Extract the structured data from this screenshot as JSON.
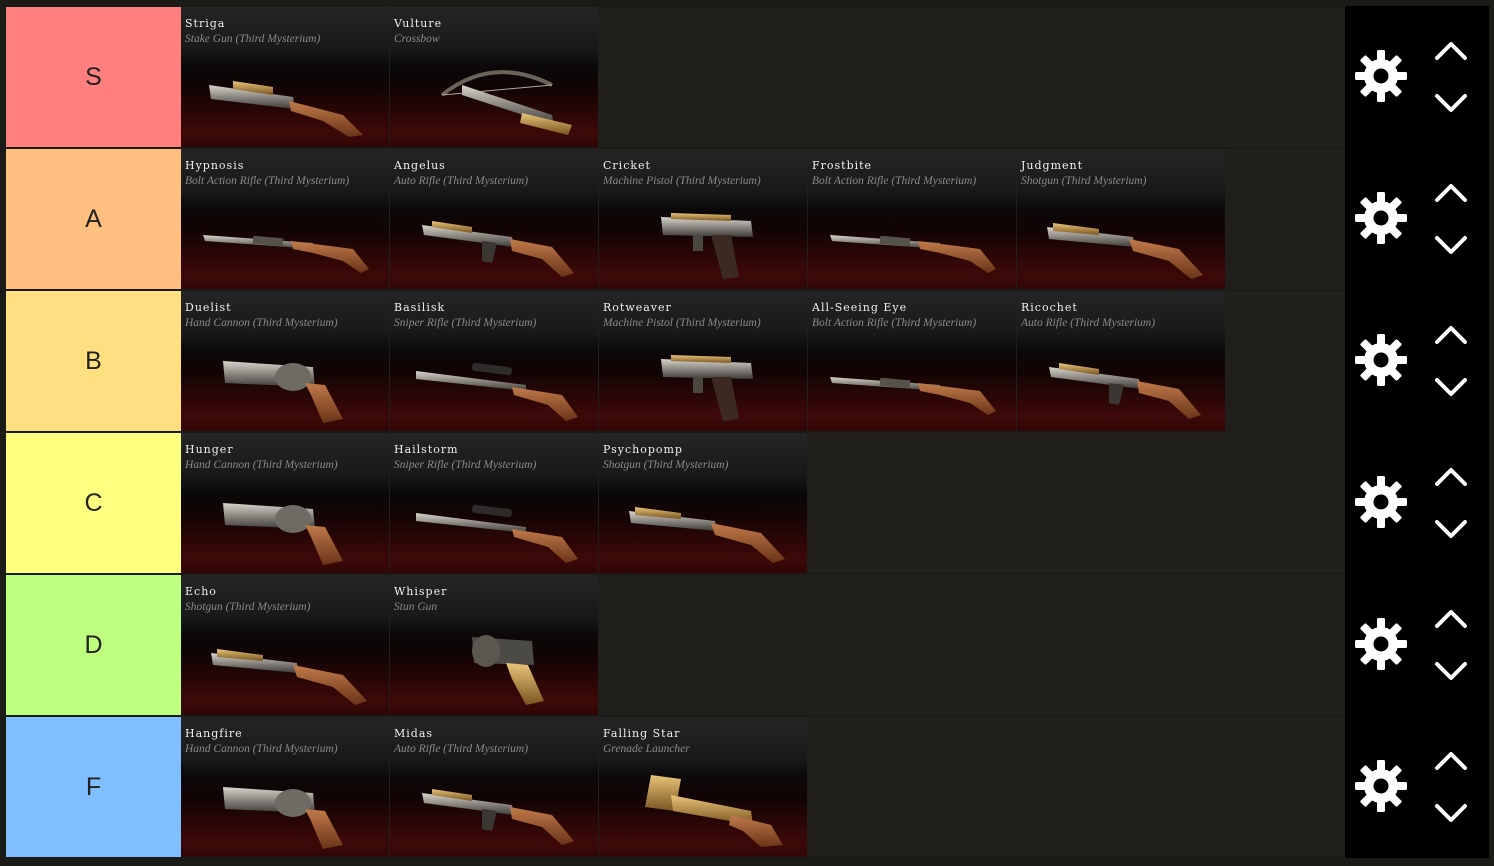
{
  "tiers": [
    {
      "label": "S",
      "color": "#ff7f7f",
      "items": [
        {
          "name": "Striga",
          "type": "Stake Gun (Third Mysterium)",
          "icon": "stake-gun-icon"
        },
        {
          "name": "Vulture",
          "type": "Crossbow",
          "icon": "crossbow-icon"
        }
      ]
    },
    {
      "label": "A",
      "color": "#ffbf7f",
      "items": [
        {
          "name": "Hypnosis",
          "type": "Bolt Action Rifle (Third Mysterium)",
          "icon": "bolt-action-rifle-icon"
        },
        {
          "name": "Angelus",
          "type": "Auto Rifle (Third Mysterium)",
          "icon": "auto-rifle-icon"
        },
        {
          "name": "Cricket",
          "type": "Machine Pistol (Third Mysterium)",
          "icon": "machine-pistol-icon"
        },
        {
          "name": "Frostbite",
          "type": "Bolt Action Rifle (Third Mysterium)",
          "icon": "bolt-action-rifle-icon"
        },
        {
          "name": "Judgment",
          "type": "Shotgun (Third Mysterium)",
          "icon": "shotgun-icon"
        }
      ]
    },
    {
      "label": "B",
      "color": "#ffdf7f",
      "items": [
        {
          "name": "Duelist",
          "type": "Hand Cannon (Third Mysterium)",
          "icon": "hand-cannon-icon"
        },
        {
          "name": "Basilisk",
          "type": "Sniper Rifle (Third Mysterium)",
          "icon": "sniper-rifle-icon"
        },
        {
          "name": "Rotweaver",
          "type": "Machine Pistol (Third Mysterium)",
          "icon": "machine-pistol-icon"
        },
        {
          "name": "All-Seeing Eye",
          "type": "Bolt Action Rifle (Third Mysterium)",
          "icon": "bolt-action-rifle-icon"
        },
        {
          "name": "Ricochet",
          "type": "Auto Rifle (Third Mysterium)",
          "icon": "auto-rifle-icon"
        }
      ]
    },
    {
      "label": "C",
      "color": "#ffff7f",
      "items": [
        {
          "name": "Hunger",
          "type": "Hand Cannon (Third Mysterium)",
          "icon": "hand-cannon-icon"
        },
        {
          "name": "Hailstorm",
          "type": "Sniper Rifle (Third Mysterium)",
          "icon": "sniper-rifle-icon"
        },
        {
          "name": "Psychopomp",
          "type": "Shotgun (Third Mysterium)",
          "icon": "shotgun-icon"
        }
      ]
    },
    {
      "label": "D",
      "color": "#bfff7f",
      "items": [
        {
          "name": "Echo",
          "type": "Shotgun (Third Mysterium)",
          "icon": "shotgun-icon"
        },
        {
          "name": "Whisper",
          "type": "Stun Gun",
          "icon": "stun-gun-icon"
        }
      ]
    },
    {
      "label": "F",
      "color": "#7fbfff",
      "items": [
        {
          "name": "Hangfire",
          "type": "Hand Cannon (Third Mysterium)",
          "icon": "hand-cannon-icon"
        },
        {
          "name": "Midas",
          "type": "Auto Rifle (Third Mysterium)",
          "icon": "auto-rifle-icon"
        },
        {
          "name": "Falling Star",
          "type": "Grenade Launcher",
          "icon": "grenade-launcher-icon"
        }
      ]
    }
  ],
  "controls": {
    "settings_icon": "gear-icon",
    "move_up_icon": "chevron-up-icon",
    "move_down_icon": "chevron-down-icon"
  }
}
